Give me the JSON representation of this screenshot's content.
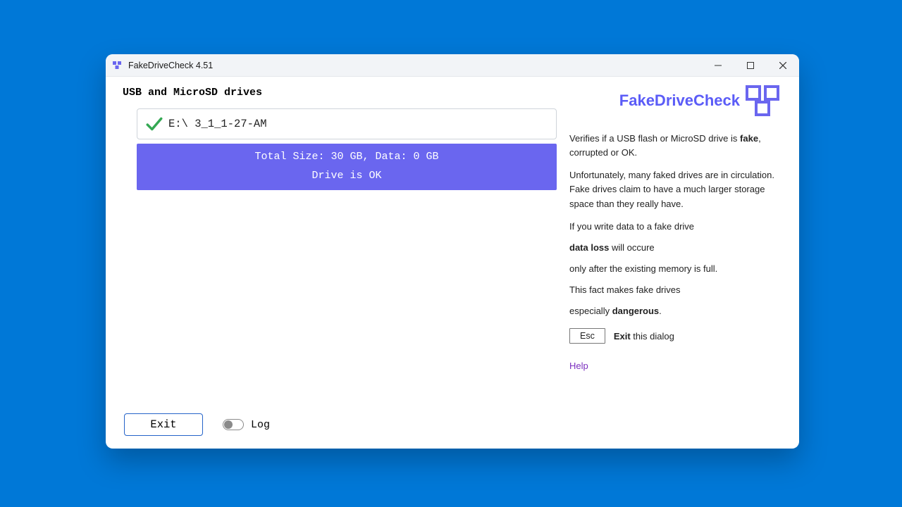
{
  "window": {
    "title": "FakeDriveCheck 4.51"
  },
  "left": {
    "section_title": "USB and MicroSD drives",
    "drive_label": "E:\\ 3_1_1-27-AM",
    "status_size_line": "Total Size: 30 GB, Data: 0 GB",
    "status_ok_line": "Drive is OK",
    "exit_label": "Exit",
    "log_label": "Log"
  },
  "right": {
    "brand": "FakeDriveCheck",
    "p1_pre": "Verifies if a USB flash or MicroSD drive is ",
    "p1_bold": "fake",
    "p1_post": ", corrupted or OK.",
    "p2": "Unfortunately, many faked drives are in circulation. Fake drives claim to have a much larger storage space than they really have.",
    "p3_l1": "If you write data to a fake drive",
    "p3_bold": "data loss",
    "p3_l2_post": " will occure",
    "p3_l3": "only after the existing memory is full.",
    "p3_l4": "This fact makes fake drives",
    "p3_l5_pre": "especially ",
    "p3_l5_bold": "dangerous",
    "p3_l5_post": ".",
    "esc_key": "Esc",
    "esc_bold": "Exit",
    "esc_post": " this dialog",
    "help": "Help"
  }
}
